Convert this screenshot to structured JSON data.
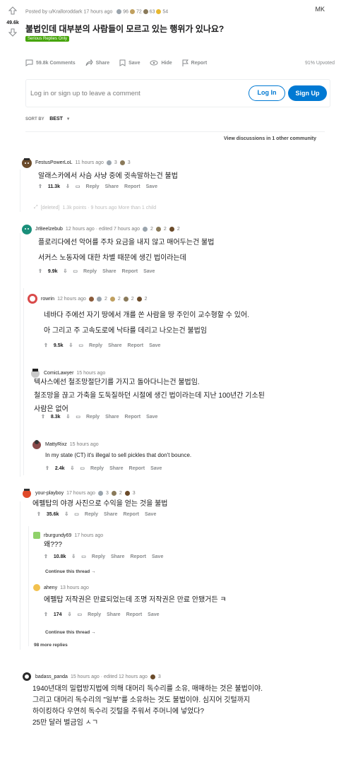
{
  "post": {
    "meta": "Posted by u/Kralloroddark 17 hours ago",
    "awards": [
      "96",
      "72",
      "63",
      "54"
    ],
    "score": "49.6k",
    "title": "불법인데 대부분의 사람들이 모르고 있는 행위가 있나요?",
    "flair": "Serious Replies Only",
    "watermark": "MK",
    "actions": {
      "comments": "59.8k Comments",
      "share": "Share",
      "save": "Save",
      "hide": "Hide",
      "report": "Report"
    },
    "upvoted": "91% Upvoted",
    "login_prompt": "Log in or sign up to leave a comment",
    "login_button": "Log In",
    "signup_button": "Sign Up",
    "sort_label": "SORT BY",
    "sort_value": "BEST",
    "view_discussions": "View discussions in 1 other community"
  },
  "comments": [
    {
      "user": "FestusPowerLoL",
      "time": "11 hours ago",
      "awards": [
        "3",
        "3"
      ],
      "body": [
        "알래스카에서 사슴 사냥 중에 귓속말하는건 불법"
      ],
      "score": "11.3k"
    },
    {
      "user": "[deleted]",
      "time": "1.3k points · 9 hours ago More than 1 child"
    },
    {
      "user": "JrBeelzebub",
      "time": "12 hours ago · edited 7 hours ago",
      "awards": [
        "2",
        "2",
        "2"
      ],
      "body": [
        "플로리다에선 악어를 주차 요금을 내지 않고 매어두는건 불법",
        "서커스 노동자에 대한 차별 때문에 생긴 법이라는데"
      ],
      "score": "9.9k"
    },
    {
      "user": "rowrin",
      "time": "12 hours ago",
      "awards": [
        "2",
        "2",
        "2",
        "2"
      ],
      "body": [
        "네바다 주에선 자기 땅에서 개를 쏜 사람을 땅 주인이 교수형할 수 있어.",
        "아 그리고 주 고속도로에 낙타를 데리고 나오는건 불법임"
      ],
      "score": "9.5k"
    },
    {
      "user": "ComicLawyer",
      "time": "15 hours ago",
      "body": [
        "텍사스에선 철조망절단기를 가지고 돌아다니는건 불법임.",
        "철조망을 끊고 가축을 도둑질하던 시절에 생긴 법이라는데 지난 100년간 기소된",
        "사람은 없어"
      ],
      "score": "8.3k"
    },
    {
      "user": "MattyRixz",
      "time": "15 hours ago",
      "body": [
        "In my state (CT) it's illegal to sell pickles that don't bounce."
      ],
      "score": "2.4k"
    },
    {
      "user": "your-playboy",
      "time": "17 hours ago",
      "awards": [
        "3",
        "2",
        "3"
      ],
      "body": [
        "에펠탑의 야경 사진으로 수익을 얻는 것을 불법"
      ],
      "score": "35.6k"
    },
    {
      "user": "rburgundy69",
      "time": "17 hours ago",
      "body": [
        "왜???"
      ],
      "score": "10.8k"
    },
    {
      "user": "aheny",
      "time": "13 hours ago",
      "body": [
        "에펠탑 저작권은 만료되었는데 조명 저작권은 만료 안됐거든 ㅋ"
      ],
      "score": "174"
    },
    {
      "user": "badass_panda",
      "time": "15 hours ago · edited 12 hours ago",
      "awards": [
        "3"
      ],
      "body": [
        "1940년대의 밀렵방지법에 의해 대머리 독수리를 소유, 매매하는 것은 불법이야.",
        "그리고 대머리 독수리의 \"일부\"를 소유하는 것도 불법이야. 심지어 깃털까지",
        "하이킹하다 우연히 독수리 깃털을 주워서 주머니에 넣었다?",
        "25만 달러 벌금임 ㅅㄱ"
      ]
    }
  ],
  "labels": {
    "reply": "Reply",
    "share": "Share",
    "report": "Report",
    "save": "Save",
    "continue_thread": "Continue this thread →",
    "more_replies": "98 more replies"
  },
  "colors": {
    "accent": "#0079d3",
    "flair": "#46a508",
    "muted": "#7c7c7c"
  }
}
